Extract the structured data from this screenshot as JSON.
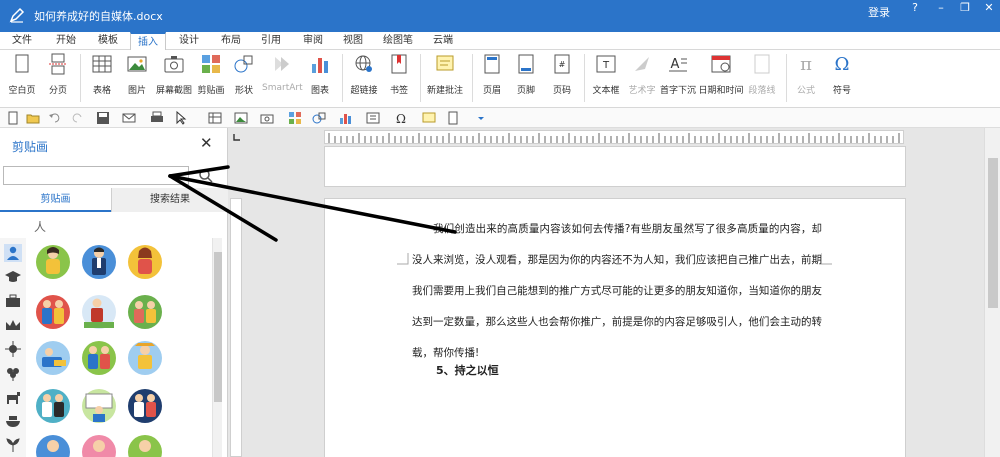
{
  "window": {
    "title": "如何养成好的自媒体.docx",
    "login_label": "登录",
    "help_label": "?",
    "min_label": "–",
    "restore_label": "❐",
    "close_label": "✕"
  },
  "menu_tabs": [
    "文件",
    "开始",
    "模板",
    "插入",
    "设计",
    "布局",
    "引用",
    "审阅",
    "视图",
    "绘图笔",
    "云端"
  ],
  "active_menu_tab": "插入",
  "ribbon": {
    "blank_page": "空白页",
    "page_break": "分页",
    "table": "表格",
    "picture": "图片",
    "screenshot": "屏幕截图",
    "clipart": "剪贴画",
    "shapes": "形状",
    "smartart": "SmartArt",
    "chart": "图表",
    "hyperlink": "超链接",
    "bookmark": "书签",
    "new_comment": "新建批注",
    "header": "页眉",
    "footer": "页脚",
    "page_number": "页码",
    "textbox": "文本框",
    "wordart": "艺术字",
    "dropcap": "首字下沉",
    "datetime": "日期和时间",
    "signature_line": "段落线",
    "equation": "公式",
    "symbol": "符号"
  },
  "clip_pane": {
    "title": "剪贴画",
    "search_value": "",
    "tab_clipart": "剪贴画",
    "tab_results": "搜索结果",
    "category": "人"
  },
  "document": {
    "paragraph": "我们创造出来的高质量内容该如何去传播?有些朋友虽然写了很多高质量的内容，却没人来浏览，没人观看，那是因为你的内容还不为人知，我们应该把自己推广出去，前期我们需要用上我们自己能想到的推广方式尽可能的让更多的朋友知道你，当知道你的朋友达到一定数量，那么这些人也会帮你推广，前提是你的内容足够吸引人，他们会主动的转载，帮你传播!",
    "heading": "5、持之以恒"
  },
  "colors": {
    "accent": "#2b74c9",
    "annotation_arrow": "#000000"
  }
}
